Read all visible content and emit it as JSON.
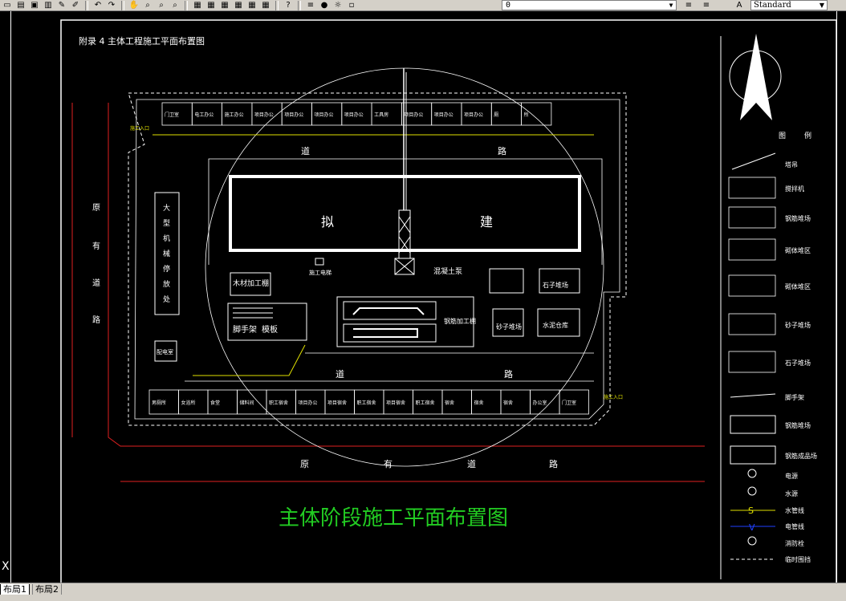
{
  "toolbar": {
    "layer_value": "0",
    "style_value": "Standard"
  },
  "tabs": [
    "布局1",
    "布局2"
  ],
  "drawing": {
    "appendix_title": "附录 4    主体工程施工平面布置图",
    "main_title": "主体阶段施工平面布置图",
    "top_buildings": [
      "门卫室",
      "电工办公",
      "施工办公",
      "项目办公",
      "项目办公",
      "项目办公",
      "项目办公",
      "工具房",
      "项目办公",
      "项目办公",
      "项目办公",
      "厕",
      "所"
    ],
    "bottom_buildings": [
      "男厕所",
      "女浴所",
      "食堂",
      "储料间",
      "职工宿舍",
      "项目办公",
      "项目宿舍",
      "职工宿舍",
      "项目宿舍",
      "职工宿舍",
      "宿舍",
      "宿舍",
      "宿舍",
      "办公室",
      "门卫室"
    ],
    "road_top": [
      "道",
      "路"
    ],
    "road_bottom": [
      "道",
      "路"
    ],
    "existing_road_left": [
      "原",
      "有",
      "道",
      "路"
    ],
    "existing_road_bottom": [
      "原",
      "有",
      "道",
      "路"
    ],
    "building_chars": [
      "拟",
      "建"
    ],
    "big_machine_area": [
      "大",
      "型",
      "机",
      "械",
      "停",
      "放",
      "处"
    ],
    "wood_shop": "木材加工棚",
    "construction_elevator": "施工电梯",
    "concrete_pump": "混凝土泵",
    "scaffold": "脚手架",
    "formwork": "模板",
    "steel_shop": "钢筋加工棚",
    "cement_store": "水泥仓库",
    "stone_yard": "石子堆场",
    "sand_yard": "砂子堆场",
    "distribution_room": "配电室",
    "entrance_top": "施工入口",
    "entrance_bottom": "施工入口",
    "legend_title": [
      "图",
      "例"
    ],
    "legend": [
      "塔吊",
      "搅拌机",
      "钢筋堆场",
      "砌体堆区",
      "砌体堆区",
      "砂子堆场",
      "石子堆场",
      "脚手架",
      "钢筋堆场",
      "钢筋成品场",
      "电源",
      "水源",
      "水管线",
      "电管线",
      "消防栓",
      "临时围挡"
    ],
    "water_line_symbol": "S",
    "power_line_symbol": "V"
  }
}
